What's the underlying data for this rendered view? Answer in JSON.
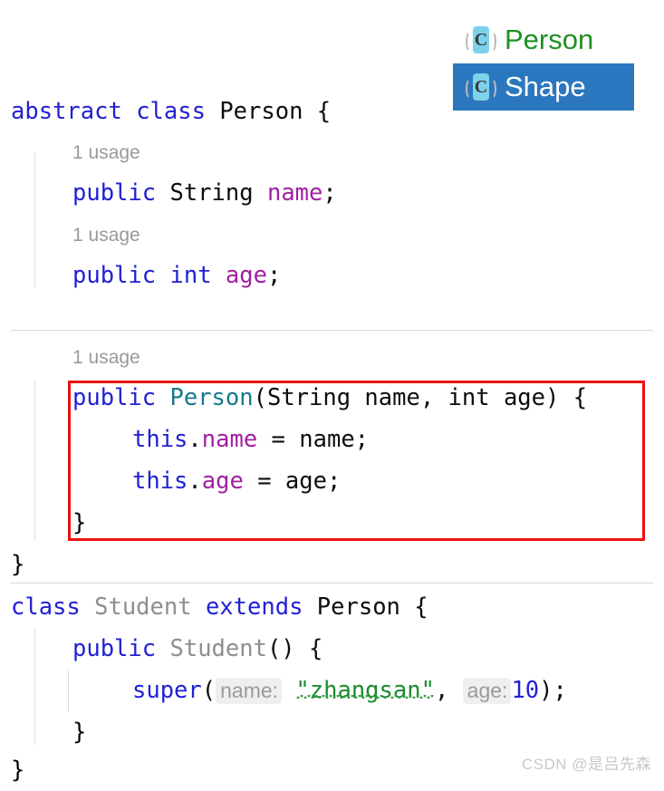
{
  "editor": {
    "language": "Java",
    "background_color": "#ffffff",
    "colors": {
      "keyword": "#2121d4",
      "type": "#0d0d0d",
      "field": "#a020a0",
      "constructor": "#16798c",
      "unused_identifier": "#8e8e8e",
      "string": "#1a8c2e",
      "number": "#2121d4",
      "usage_hint": "#9a9a9a",
      "parameter_hint_bg": "#efefef",
      "parameter_hint_text": "#9b9b9b",
      "separator": "#d8d8d8",
      "annotation": "#ee1111"
    },
    "usage_hints": {
      "name_field": "1 usage",
      "age_field": "1 usage",
      "constructor": "1 usage"
    },
    "lines": {
      "class_decl": {
        "kw_abstract": "abstract",
        "kw_class": "class",
        "type_name": "Person",
        "brace": "{"
      },
      "field_name": {
        "kw_public": "public",
        "type": "String",
        "name": "name",
        "semi": ";"
      },
      "field_age": {
        "kw_public": "public",
        "type": "int",
        "name": "age",
        "semi": ";"
      },
      "ctor_sig": {
        "kw_public": "public",
        "ctor_name": "Person",
        "params": "(String name, int age) {"
      },
      "assign_name": {
        "kw_this": "this",
        "dot": ".",
        "field": "name",
        "rest": " = name;"
      },
      "assign_age": {
        "kw_this": "this",
        "dot": ".",
        "field": "age",
        "rest": " = age;"
      },
      "ctor_close": "}",
      "class_close": "}",
      "student_decl": {
        "kw_class": "class",
        "name": "Student",
        "kw_extends": "extends",
        "super_type": "Person",
        "brace": "{"
      },
      "student_ctor": {
        "kw_public": "public",
        "name": "Student",
        "rest": "() {"
      },
      "super_call": {
        "kw_super": "super",
        "open_paren": "(",
        "hint_name": "name:",
        "string_value": "\"zhangsan\"",
        "comma": ",",
        "hint_age": "age:",
        "number_value": "10",
        "close": ");"
      },
      "student_ctor_close": "}",
      "student_class_close": "}"
    }
  },
  "completion_popup": {
    "items": [
      {
        "label": "Person",
        "icon": "java-class-icon",
        "icon_letter": "C",
        "selected": false
      },
      {
        "label": "Shape",
        "icon": "java-class-icon",
        "icon_letter": "C",
        "selected": true
      }
    ],
    "selected_background": "#2b77bf"
  },
  "watermark": {
    "text": "CSDN @是吕先森"
  }
}
